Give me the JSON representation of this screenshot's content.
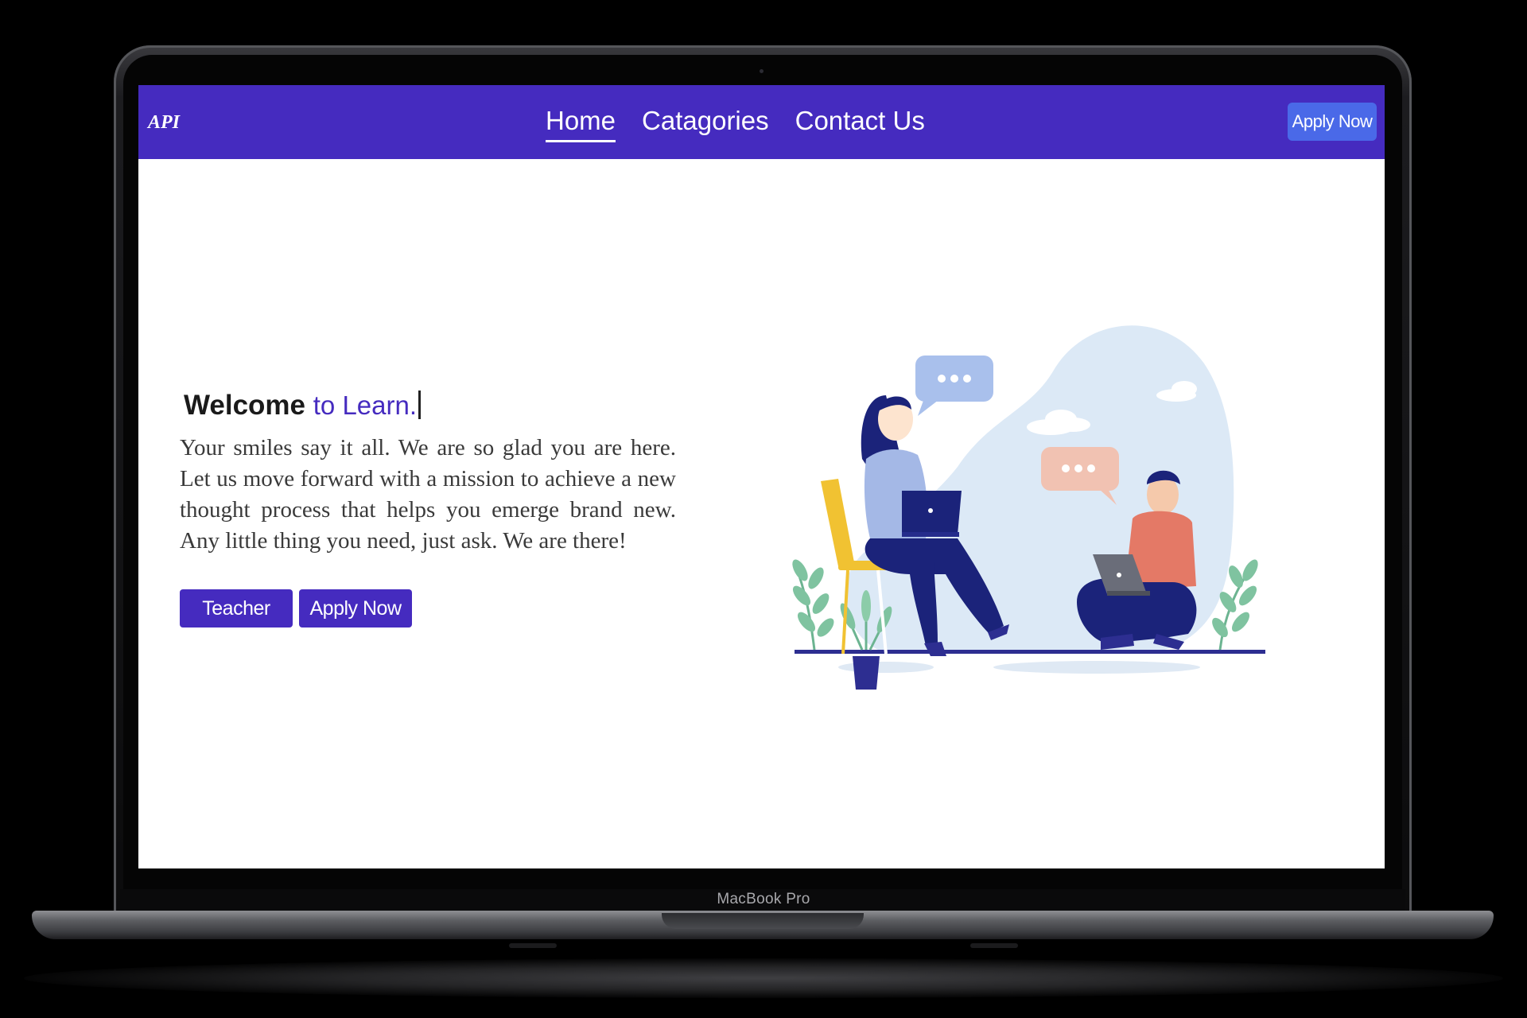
{
  "device": {
    "label": "MacBook Pro"
  },
  "navbar": {
    "brand": "API",
    "links": [
      {
        "label": "Home",
        "active": true
      },
      {
        "label": "Catagories",
        "active": false
      },
      {
        "label": "Contact Us",
        "active": false
      }
    ],
    "apply_label": "Apply Now"
  },
  "hero": {
    "title_strong": "Welcome",
    "title_accent": "to Learn.",
    "text": "Your smiles say it all. We are so glad you are here. Let us move forward with a mission to achieve a new thought process that helps you emerge brand new. Any little thing you need, just ask. We are there!",
    "buttons": [
      {
        "label": "Teacher"
      },
      {
        "label": "Apply Now"
      }
    ]
  },
  "colors": {
    "brand": "#452bbf",
    "nav_button": "#4a69e8",
    "background": "#ffffff"
  }
}
